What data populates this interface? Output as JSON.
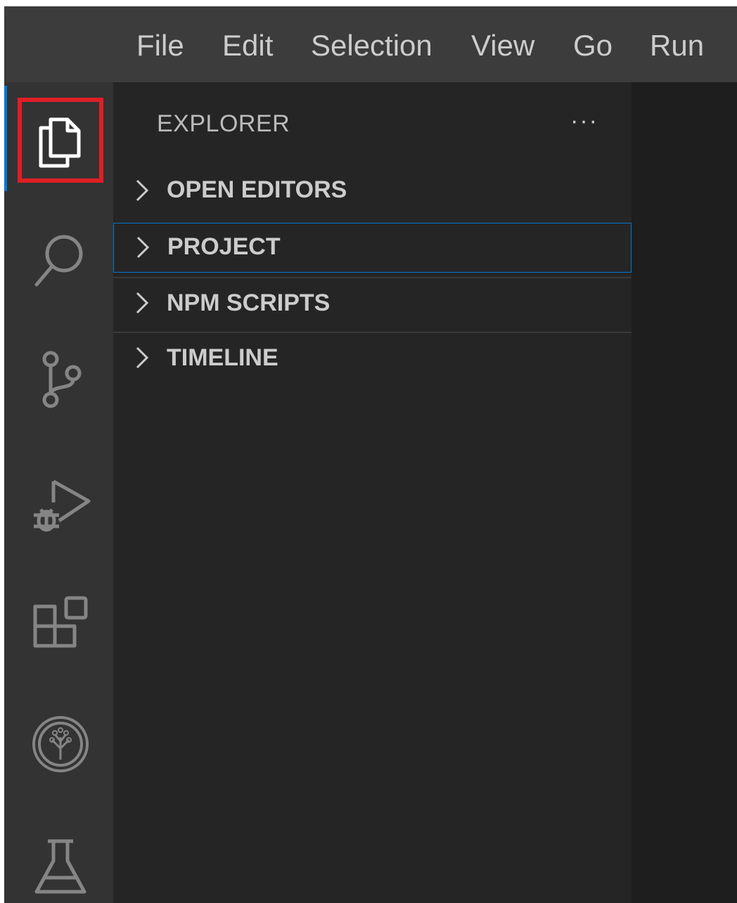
{
  "menu": {
    "items": [
      "File",
      "Edit",
      "Selection",
      "View",
      "Go",
      "Run"
    ]
  },
  "activity_bar": {
    "icons": [
      "explorer-icon",
      "search-icon",
      "source-control-icon",
      "run-debug-icon",
      "extensions-icon",
      "tree-view-icon",
      "testing-icon"
    ],
    "active": "explorer-icon",
    "accent_color": "#0078d4",
    "highlight_color": "#e01e25"
  },
  "sidebar": {
    "title": "EXPLORER",
    "more_actions": "···",
    "sections": [
      {
        "label": "OPEN EDITORS"
      },
      {
        "label": "PROJECT"
      },
      {
        "label": "NPM SCRIPTS"
      },
      {
        "label": "TIMELINE"
      }
    ]
  }
}
